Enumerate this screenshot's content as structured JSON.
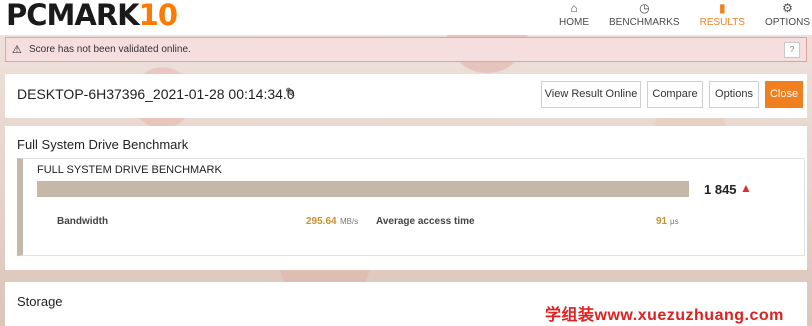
{
  "app": {
    "logo_main": "PCMARK",
    "logo_ten": "10"
  },
  "nav": [
    {
      "icon": "⌂",
      "label": "HOME",
      "active": false
    },
    {
      "icon": "◷",
      "label": "BENCHMARKS",
      "active": false
    },
    {
      "icon": "▮",
      "label": "RESULTS",
      "active": true
    },
    {
      "icon": "⚙",
      "label": "OPTIONS",
      "active": false
    }
  ],
  "warning": {
    "icon": "⚠",
    "text": "Score has not been validated online.",
    "help": "?"
  },
  "result": {
    "title": "DESKTOP-6H37396_2021-01-28 00:14:34.0",
    "edit_icon": "✎",
    "buttons": [
      "View Result Online",
      "Compare",
      "Options",
      "Close"
    ]
  },
  "benchmark": {
    "section_title": "Full System Drive Benchmark",
    "sub_title": "FULL SYSTEM DRIVE BENCHMARK",
    "score": "1 845",
    "score_warning_icon": "▲",
    "bandwidth_label": "Bandwidth",
    "bandwidth_value": "295.64",
    "bandwidth_unit": "MB/s",
    "access_label": "Average access time",
    "access_value": "91",
    "access_unit": "μs"
  },
  "storage": {
    "title": "Storage"
  },
  "watermark": "学组装www.xuezuzhuang.com"
}
